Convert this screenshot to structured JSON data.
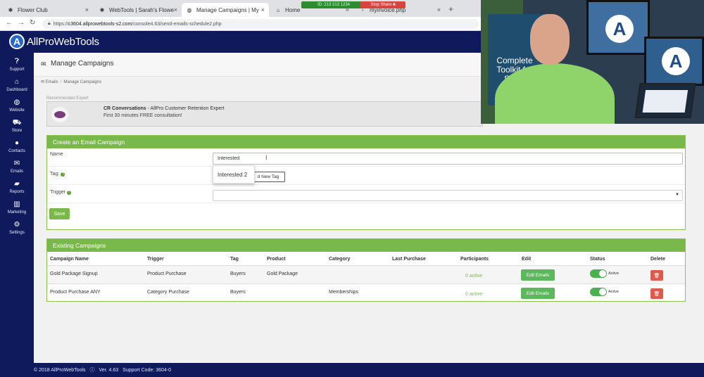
{
  "browser": {
    "tabs": [
      {
        "label": "Flower Club",
        "icon": "gear-icon"
      },
      {
        "label": "WebTools | Sarah's Flowe",
        "icon": "gear-icon"
      },
      {
        "label": "Manage Campaigns | My",
        "icon": "globe-icon"
      },
      {
        "label": "Home",
        "icon": "home-icon"
      },
      {
        "label": "myinvoice.php",
        "icon": "page-icon"
      }
    ],
    "screen_share_id": "ID: 213 213 1234",
    "stop_share_label": "Stop Share",
    "url_scheme": "https://",
    "url_host": "c3604.allprowebtools-s2.com",
    "url_path": "/console4.63/send-emails-schedule2.php"
  },
  "header": {
    "logo_text": "AllProWebTools"
  },
  "sidebar": {
    "items": [
      {
        "label": "Support",
        "icon": "help-icon"
      },
      {
        "label": "Dashboard",
        "icon": "home-icon"
      },
      {
        "label": "Website",
        "icon": "globe-icon"
      },
      {
        "label": "Store",
        "icon": "cart-icon"
      },
      {
        "label": "Contacts",
        "icon": "person-icon"
      },
      {
        "label": "Emails",
        "icon": "envelope-icon"
      },
      {
        "label": "Reports",
        "icon": "folder-icon"
      },
      {
        "label": "Marketing",
        "icon": "bar-chart-icon"
      },
      {
        "label": "Settings",
        "icon": "gear-icon"
      }
    ]
  },
  "page": {
    "title": "Manage Campaigns",
    "breadcrumb": [
      "Emails",
      "Manage Campaigns"
    ]
  },
  "expert": {
    "section_label": "Recommended Expert",
    "name": "CR Conversations",
    "tagline": "AllPro Customer Retention Expert",
    "offer": "First 30 minutes FREE consultation!"
  },
  "create_campaign": {
    "title": "Create an Email Campaign",
    "name_label": "Name",
    "name_value": "Interested",
    "autocomplete_option": "Interested 2",
    "tag_label": "Tag:",
    "add_tag_label": "d New Tag",
    "trigger_label": "Trigger",
    "save_label": "Save"
  },
  "existing": {
    "title": "Existing Campaigns",
    "columns": [
      "Campaign Name",
      "Trigger",
      "Tag",
      "Product",
      "Category",
      "Last Purchase",
      "Participants",
      "Edit",
      "Status",
      "Delete"
    ],
    "rows": [
      {
        "name": "Gold Package Signup",
        "trigger": "Product Purchase",
        "tag": "Buyers",
        "product": "Gold Package",
        "category": "",
        "last_purchase": "",
        "participants": "0 active",
        "edit": "Edit Emails",
        "status": "Active"
      },
      {
        "name": "Product Purchase ANY",
        "trigger": "Category Purchase",
        "tag": "Buyers",
        "product": "",
        "category": "Memberships",
        "last_purchase": "",
        "participants": "0 active",
        "edit": "Edit Emails",
        "status": "Active"
      }
    ]
  },
  "footer": {
    "copyright": "© 2018 AllProWebTools",
    "version": "Ver. 4.63",
    "support_code": "Support Code: 3604-0"
  },
  "webcam": {
    "poster_text": "Complete Toolkit for Small Busin"
  },
  "colors": {
    "navy": "#0f1a5c",
    "green": "#79b84a",
    "danger": "#e05a4c"
  }
}
